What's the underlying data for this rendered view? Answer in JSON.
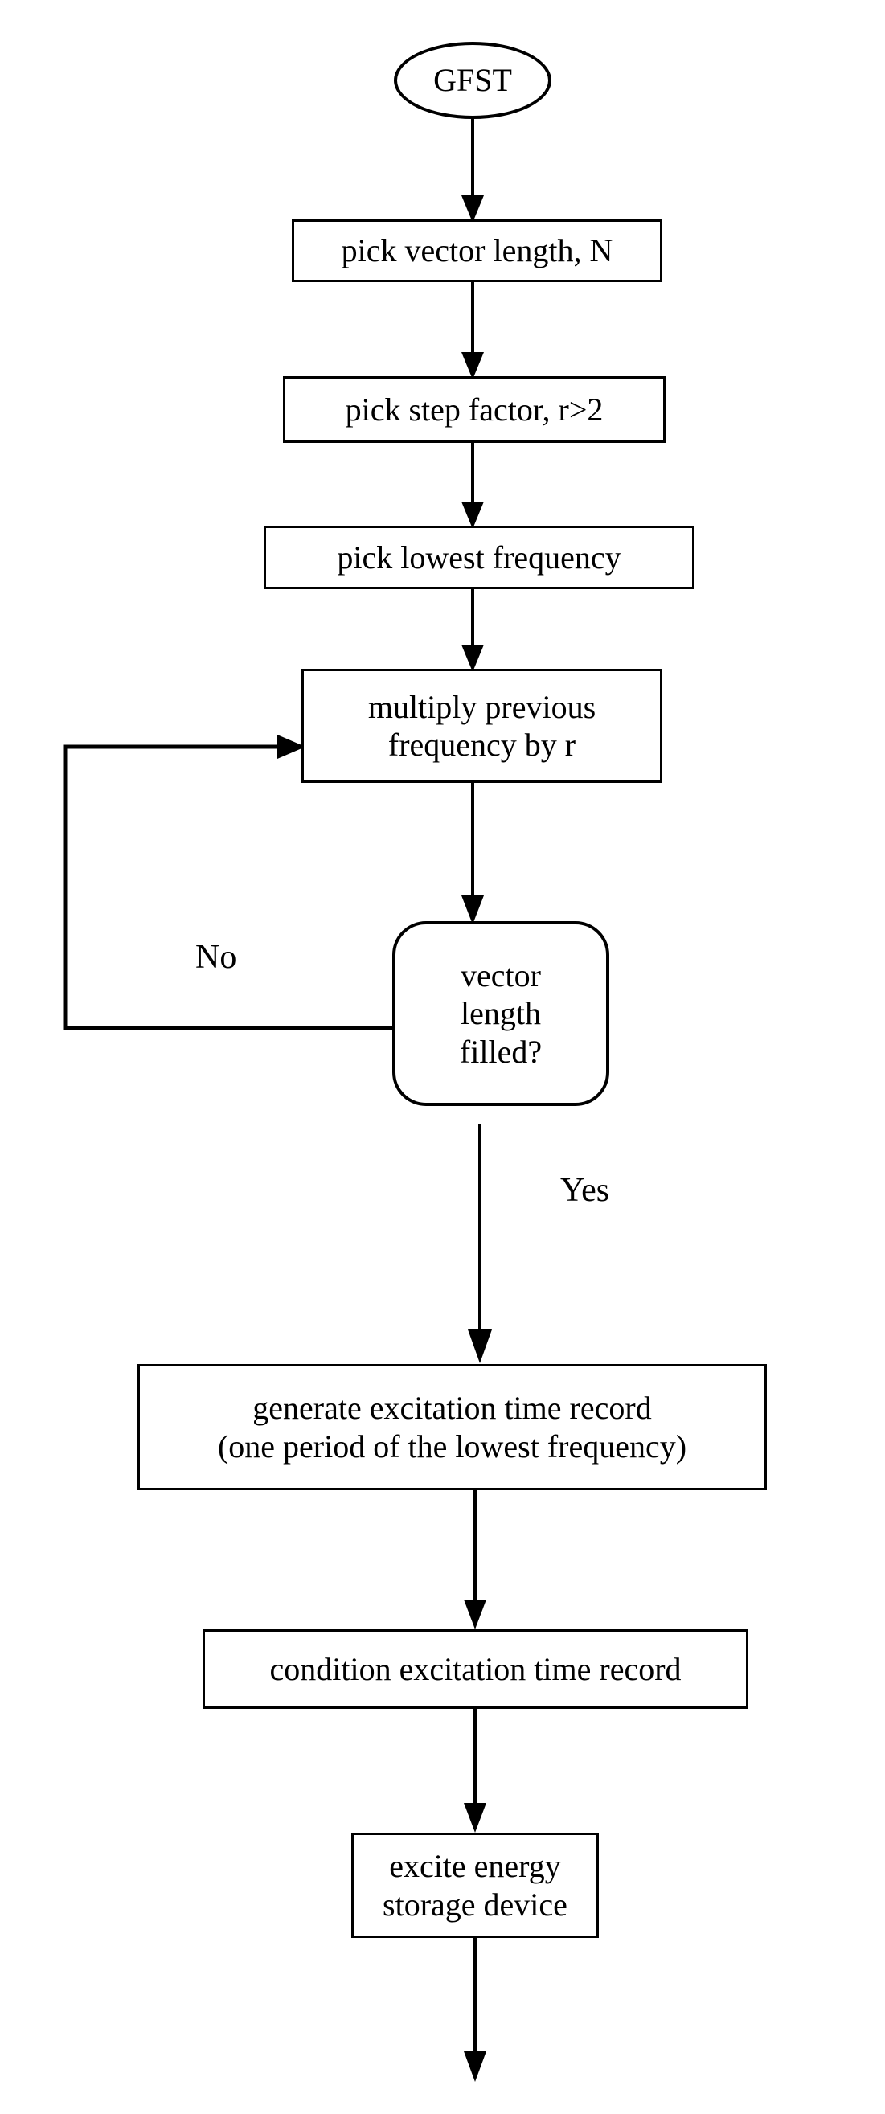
{
  "diagram": {
    "title": "GFST",
    "nodes": [
      {
        "id": "start",
        "label": "GFST",
        "shape": "ellipse"
      },
      {
        "id": "veclen",
        "label": "pick vector length, N",
        "shape": "rect"
      },
      {
        "id": "stepfactor",
        "label": "pick step factor, r>2",
        "shape": "rect"
      },
      {
        "id": "lowfreq",
        "label": "pick lowest frequency",
        "shape": "rect"
      },
      {
        "id": "multiply",
        "label": "multiply previous\nfrequency by r",
        "shape": "rect"
      },
      {
        "id": "decision",
        "label": "vector\nlength\nfilled?",
        "shape": "rounded"
      },
      {
        "id": "generate",
        "label": "generate excitation time record\n(one period of the lowest frequency)",
        "shape": "rect"
      },
      {
        "id": "condition",
        "label": "condition excitation time record",
        "shape": "rect"
      },
      {
        "id": "excite",
        "label": "excite energy\nstorage device",
        "shape": "rect"
      }
    ],
    "edge_labels": [
      {
        "id": "no",
        "text": "No"
      },
      {
        "id": "yes",
        "text": "Yes"
      }
    ],
    "colors": {
      "stroke": "#000000",
      "fill": "#ffffff",
      "text": "#000000"
    }
  }
}
